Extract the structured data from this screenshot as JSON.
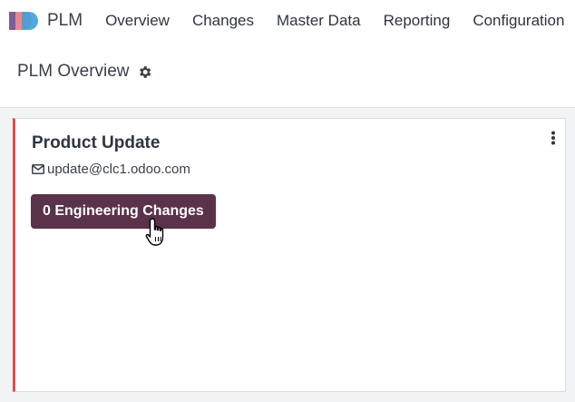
{
  "navbar": {
    "app_name": "PLM",
    "menu": [
      "Overview",
      "Changes",
      "Master Data",
      "Reporting",
      "Configuration"
    ]
  },
  "page": {
    "title": "PLM Overview",
    "settings_icon": "gear-icon"
  },
  "card": {
    "title": "Product Update",
    "email": "update@clc1.odoo.com",
    "email_icon": "envelope-icon",
    "button_label": "0 Engineering Changes",
    "menu_icon": "kebab-icon",
    "accent_color": "#e04b4b",
    "button_color": "#5a3249"
  }
}
